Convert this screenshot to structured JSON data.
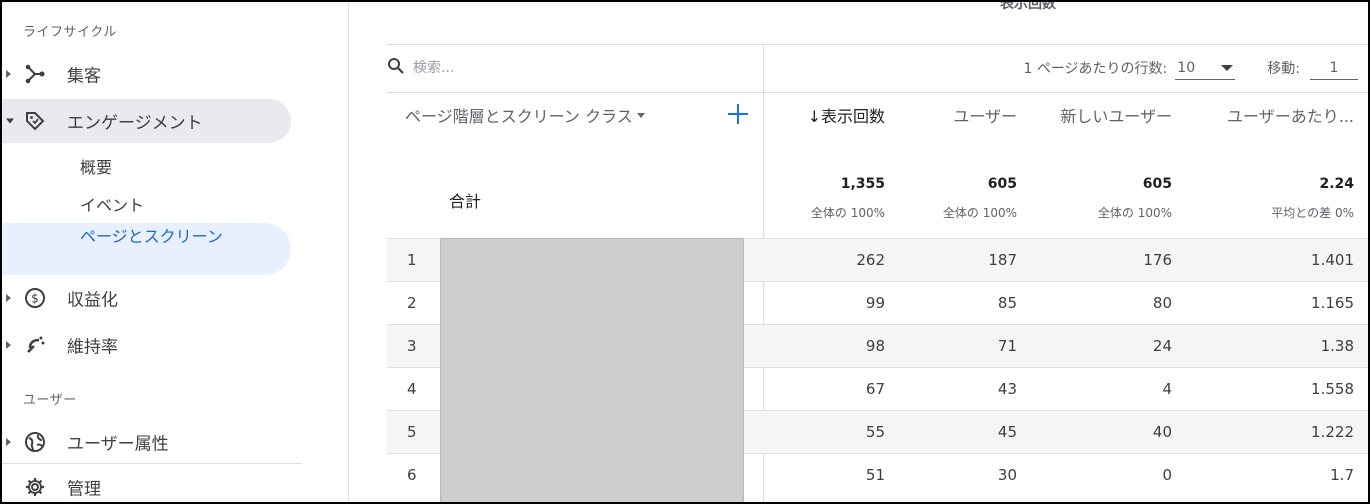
{
  "sidebar": {
    "section_lifecycle": "ライフサイクル",
    "section_user": "ユーザー",
    "items": [
      {
        "label": "集客",
        "icon": "acquisition-icon"
      },
      {
        "label": "エンゲージメント",
        "icon": "engagement-tag-icon"
      },
      {
        "label": "収益化",
        "icon": "dollar-circle-icon"
      },
      {
        "label": "維持率",
        "icon": "retention-icon"
      },
      {
        "label": "ユーザー属性",
        "icon": "globe-icon"
      }
    ],
    "engagement_sub": [
      "概要",
      "イベント",
      "ページとスクリーン"
    ],
    "admin_label": "管理"
  },
  "table": {
    "top_header_cut": "表示回数",
    "search_placeholder": "検索...",
    "rows_per_page_label": "1 ページあたりの行数:",
    "rows_per_page_value": "10",
    "goto_label": "移動:",
    "goto_value": "1",
    "dimension_header": "ページ階層とスクリーン クラス",
    "columns": [
      "↓表示回数",
      "ユーザー",
      "新しいユーザー",
      "ユーザーあたり..."
    ],
    "total": {
      "label": "合計",
      "values": [
        "1,355",
        "605",
        "605",
        "2.24"
      ],
      "subs": [
        "全体の 100%",
        "全体の 100%",
        "全体の 100%",
        "平均との差 0%"
      ]
    },
    "rows": [
      {
        "idx": "1",
        "values": [
          "262",
          "187",
          "176",
          "1.401"
        ]
      },
      {
        "idx": "2",
        "values": [
          "99",
          "85",
          "80",
          "1.165"
        ]
      },
      {
        "idx": "3",
        "values": [
          "98",
          "71",
          "24",
          "1.38"
        ]
      },
      {
        "idx": "4",
        "values": [
          "67",
          "43",
          "4",
          "1.558"
        ]
      },
      {
        "idx": "5",
        "values": [
          "55",
          "45",
          "40",
          "1.222"
        ]
      },
      {
        "idx": "6",
        "values": [
          "51",
          "30",
          "0",
          "1.7"
        ]
      }
    ]
  },
  "colors": {
    "accent": "#1a73e8",
    "active_bg": "#e8f0fe",
    "redaction": "#cfcdcd"
  }
}
